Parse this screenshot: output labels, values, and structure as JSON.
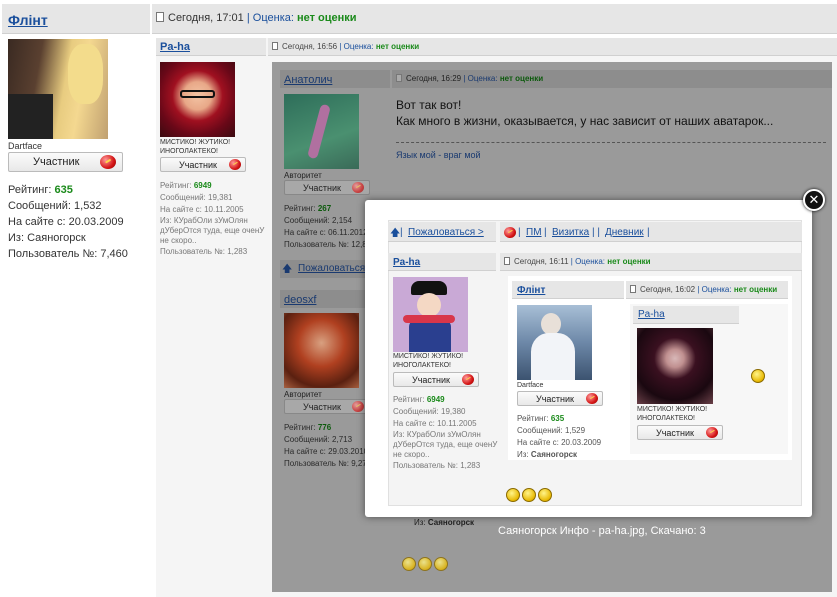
{
  "post_main": {
    "author": "Флінт",
    "time": "Сегодня, 17:01",
    "rating_label": "Оценка:",
    "rating_value": "нет оценки",
    "caption": "Dartface",
    "rank_button": "Участник",
    "stats": [
      {
        "label": "Рейтинг:",
        "value": "635",
        "green": true
      },
      {
        "label": "Сообщений:",
        "value": "1,532"
      },
      {
        "label": "На сайте с:",
        "value": "20.03.2009"
      },
      {
        "label": "Из:",
        "value": "Саяногорск"
      },
      {
        "label": "Пользователь №:",
        "value": "7,460"
      }
    ]
  },
  "post_paha": {
    "author": "Pa-ha",
    "time": "Сегодня, 16:56",
    "rating_label": "Оценка:",
    "rating_value": "нет оценки",
    "status": "МИСТИКО! ЖУТИКО! ИНОГОЛАКТЕКО!",
    "rank_button": "Участник",
    "stats": [
      {
        "label": "Рейтинг:",
        "value": "6949",
        "green": true
      },
      {
        "label": "Сообщений:",
        "value": "19,381"
      },
      {
        "label": "На сайте с:",
        "value": "10.11.2005"
      },
      {
        "label": "Из:",
        "value": "КУрабОли зУмОлян дУберОтся туда, еще оченУ не скоро.."
      },
      {
        "label": "Пользователь №:",
        "value": "1,283"
      }
    ]
  },
  "post_anatolich": {
    "author": "Анатолич",
    "time": "Сегодня, 16:29",
    "rating_label": "Оценка:",
    "rating_value": "нет оценки",
    "message_line1": "Вот так вот!",
    "message_line2": "Как много в жизни, оказывается, у нас зависит от наших аватарок...",
    "signature": "Язык мой - враг мой",
    "caption": "Авторитет",
    "rank_button": "Участник",
    "stats": [
      {
        "label": "Рейтинг:",
        "value": "267",
        "green": true
      },
      {
        "label": "Сообщений:",
        "value": "2,154"
      },
      {
        "label": "На сайте с:",
        "value": "06.11.2012"
      },
      {
        "label": "Пользователь №:",
        "value": "12,8"
      }
    ],
    "report_link": "Пожаловаться"
  },
  "post_deosxf": {
    "author": "deosxf",
    "caption": "Авторитет",
    "rank_button": "Участник",
    "stats": [
      {
        "label": "Рейтинг:",
        "value": "776",
        "green": true
      },
      {
        "label": "Сообщений:",
        "value": "2,713"
      },
      {
        "label": "На сайте с:",
        "value": "29.03.2010"
      },
      {
        "label": "Пользователь №:",
        "value": "9,27"
      }
    ],
    "location_label": "Из:",
    "location_value": "Саяногорск"
  },
  "lightbox": {
    "links": {
      "report": "Пожаловаться >",
      "pm": "ПМ",
      "card": "Визитка",
      "diary": "Дневник"
    },
    "paha": {
      "author": "Pa-ha",
      "time": "Сегодня, 16:11",
      "rating_label": "Оценка:",
      "rating_value": "нет оценки",
      "status": "МИСТИКО! ЖУТИКО! ИНОГОЛАКТЕКО!",
      "rank_button": "Участник",
      "stats": [
        {
          "label": "Рейтинг:",
          "value": "6949",
          "green": true
        },
        {
          "label": "Сообщений:",
          "value": "19,380"
        },
        {
          "label": "На сайте с:",
          "value": "10.11.2005"
        },
        {
          "label": "Из:",
          "value": "КУрабОли зУмОлян дУберОтся туда, еще оченУ не скоро.."
        },
        {
          "label": "Пользователь №:",
          "value": "1,283"
        }
      ]
    },
    "flint": {
      "author": "Флінт",
      "time": "Сегодня, 16:02",
      "rating_label": "Оценка:",
      "rating_value": "нет оценки",
      "caption": "Dartface",
      "rank_button": "Участник",
      "stats": [
        {
          "label": "Рейтинг:",
          "value": "635",
          "green": true
        },
        {
          "label": "Сообщений:",
          "value": "1,529"
        },
        {
          "label": "На сайте с:",
          "value": "20.03.2009"
        },
        {
          "label": "Из:",
          "value": "Саяногорск"
        }
      ]
    },
    "paha2": {
      "author": "Pa-ha",
      "status": "МИСТИКО! ЖУТИКО! ИНОГОЛАКТЕКО!",
      "rank_button": "Участник"
    },
    "caption": "Саяногорск Инфо - pa-ha.jpg, Скачано: 3"
  }
}
